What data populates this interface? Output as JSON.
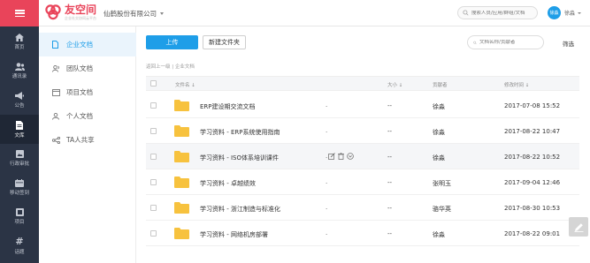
{
  "header": {
    "logo_title": "友空间",
    "logo_subtitle": "企业社交协同云平台",
    "company": "仙鹤股份有限公司",
    "search_placeholder": "搜索人员/应用/群组/文档",
    "user_name": "徐淼",
    "avatar_text": "徐淼"
  },
  "leftnav": {
    "items": [
      {
        "label": "首页",
        "icon": "home-icon"
      },
      {
        "label": "通讯录",
        "icon": "contacts-icon"
      },
      {
        "label": "公告",
        "icon": "megaphone-icon"
      },
      {
        "label": "文库",
        "icon": "document-icon"
      },
      {
        "label": "行政审批",
        "icon": "approval-icon"
      },
      {
        "label": "移动签到",
        "icon": "calendar-icon"
      },
      {
        "label": "项目",
        "icon": "project-icon"
      },
      {
        "label": "话题",
        "icon": "hashtag-icon"
      }
    ],
    "active": "文库"
  },
  "subnav": {
    "items": [
      {
        "label": "企业文档",
        "icon": "file-icon"
      },
      {
        "label": "团队文档",
        "icon": "team-icon"
      },
      {
        "label": "项目文档",
        "icon": "folder-outline-icon"
      },
      {
        "label": "个人文档",
        "icon": "person-icon"
      },
      {
        "label": "TA人共享",
        "icon": "share-icon"
      }
    ],
    "active": "企业文档"
  },
  "toolbar": {
    "upload_label": "上传",
    "new_folder_label": "新建文件夹",
    "search_placeholder": "文档名称/贡献者",
    "filter_label": "筛选"
  },
  "breadcrumb": "返回上一级 | 企业文档",
  "table": {
    "headers": {
      "name": "文件名 ↓",
      "size": "大小 ↓",
      "owner": "贡献者",
      "mtime": "修改时间 ↓"
    },
    "rows": [
      {
        "name": "ERP建设期交流文档",
        "dot": ".",
        "size": "--",
        "owner": "徐淼",
        "mtime": "2017-07-08 15:52"
      },
      {
        "name": "学习资料 - ERP系统使用指南",
        "dot": ".",
        "size": "--",
        "owner": "徐淼",
        "mtime": "2017-08-22 10:47"
      },
      {
        "name": "学习资料 - ISO体系培训课件",
        "dot": ".",
        "size": "--",
        "owner": "徐淼",
        "mtime": "2017-08-22 10:52"
      },
      {
        "name": "学习资料 - 卓越绩效",
        "dot": ".",
        "size": "--",
        "owner": "张明玉",
        "mtime": "2017-09-04 12:46"
      },
      {
        "name": "学习资料 - 浙江制造与标准化",
        "dot": ".",
        "size": "--",
        "owner": "骆华英",
        "mtime": "2017-08-30 10:53"
      },
      {
        "name": "学习资料 - 网络机房部署",
        "dot": ".",
        "size": "--",
        "owner": "徐淼",
        "mtime": "2017-08-22 09:01"
      }
    ]
  },
  "colors": {
    "accent": "#1e9ee8",
    "brand_red": "#e9445a",
    "nav_bg": "#2b3445",
    "folder": "#f7c23e"
  }
}
